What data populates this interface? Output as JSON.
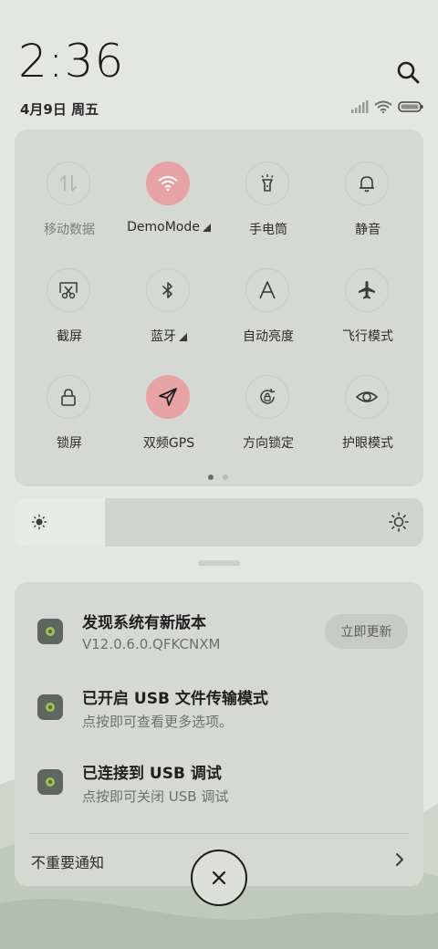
{
  "header": {
    "time": "2:36",
    "date": "4月9日 周五"
  },
  "quick_settings": {
    "tiles": [
      {
        "label": "移动数据",
        "icon": "mobile-data-icon",
        "active": false
      },
      {
        "label": "DemoMode",
        "icon": "wifi-icon",
        "active": true
      },
      {
        "label": "手电筒",
        "icon": "flashlight-icon",
        "active": false
      },
      {
        "label": "静音",
        "icon": "bell-icon",
        "active": false
      },
      {
        "label": "截屏",
        "icon": "screenshot-icon",
        "active": false
      },
      {
        "label": "蓝牙",
        "icon": "bluetooth-icon",
        "active": false
      },
      {
        "label": "自动亮度",
        "icon": "auto-brightness-icon",
        "active": false
      },
      {
        "label": "飞行模式",
        "icon": "airplane-icon",
        "active": false
      },
      {
        "label": "锁屏",
        "icon": "lock-icon",
        "active": false
      },
      {
        "label": "双频GPS",
        "icon": "gps-icon",
        "active": true
      },
      {
        "label": "方向锁定",
        "icon": "rotation-lock-icon",
        "active": false
      },
      {
        "label": "护眼模式",
        "icon": "eye-icon",
        "active": false
      }
    ],
    "active_color": "#e7a3a4",
    "page_count": 2,
    "current_page": 1
  },
  "brightness": {
    "level": 0.22
  },
  "notifications": [
    {
      "title": "发现系统有新版本",
      "subtitle": "V12.0.6.0.QFKCNXM",
      "action": "立即更新"
    },
    {
      "title": "已开启 USB 文件传输模式",
      "subtitle": "点按即可查看更多选项。"
    },
    {
      "title": "已连接到 USB 调试",
      "subtitle": "点按即可关闭 USB 调试"
    }
  ],
  "minor_notifications_label": "不重要通知"
}
